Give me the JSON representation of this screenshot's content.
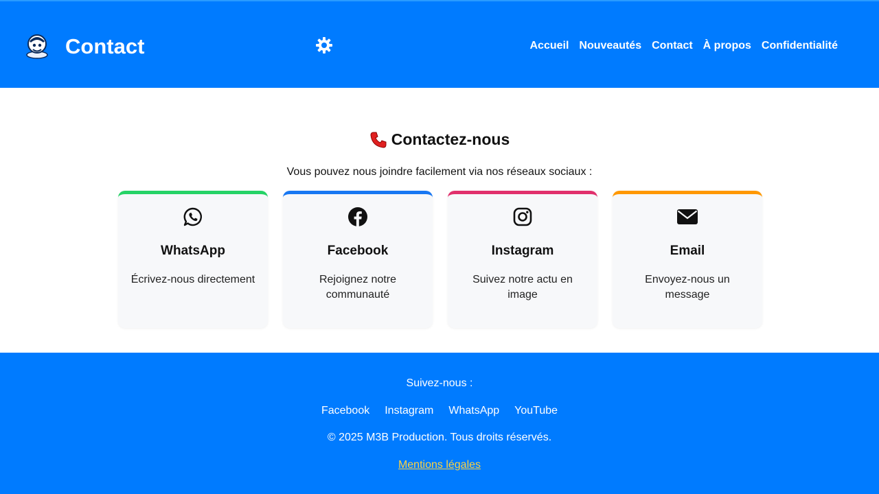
{
  "header": {
    "title": "Contact",
    "logo_icon": "mascot-logo-icon",
    "theme_toggle_icon": "gear-icon",
    "nav": [
      {
        "label": "Accueil"
      },
      {
        "label": "Nouveautés"
      },
      {
        "label": "Contact"
      },
      {
        "label": "À propos"
      },
      {
        "label": "Confidentialité"
      }
    ]
  },
  "main": {
    "title": "Contactez-nous",
    "title_icon": "phone-icon",
    "intro": "Vous pouvez nous joindre facilement via nos réseaux sociaux :",
    "cards": [
      {
        "title": "WhatsApp",
        "text": "Écrivez-nous directement",
        "icon": "whatsapp-icon",
        "accent": "#25d366"
      },
      {
        "title": "Facebook",
        "text": "Rejoignez notre communauté",
        "icon": "facebook-icon",
        "accent": "#1877f2"
      },
      {
        "title": "Instagram",
        "text": "Suivez notre actu en image",
        "icon": "instagram-icon",
        "accent": "#e1306c"
      },
      {
        "title": "Email",
        "text": "Envoyez-nous un message",
        "icon": "envelope-icon",
        "accent": "#ff9800"
      }
    ]
  },
  "footer": {
    "follow": "Suivez-nous :",
    "links": [
      {
        "label": "Facebook"
      },
      {
        "label": "Instagram"
      },
      {
        "label": "WhatsApp"
      },
      {
        "label": "YouTube"
      }
    ],
    "copyright": "© 2025 M3B Production. Tous droits réservés.",
    "legal": "Mentions légales"
  },
  "colors": {
    "primary": "#007bff",
    "legal_link": "#ffd23f"
  }
}
